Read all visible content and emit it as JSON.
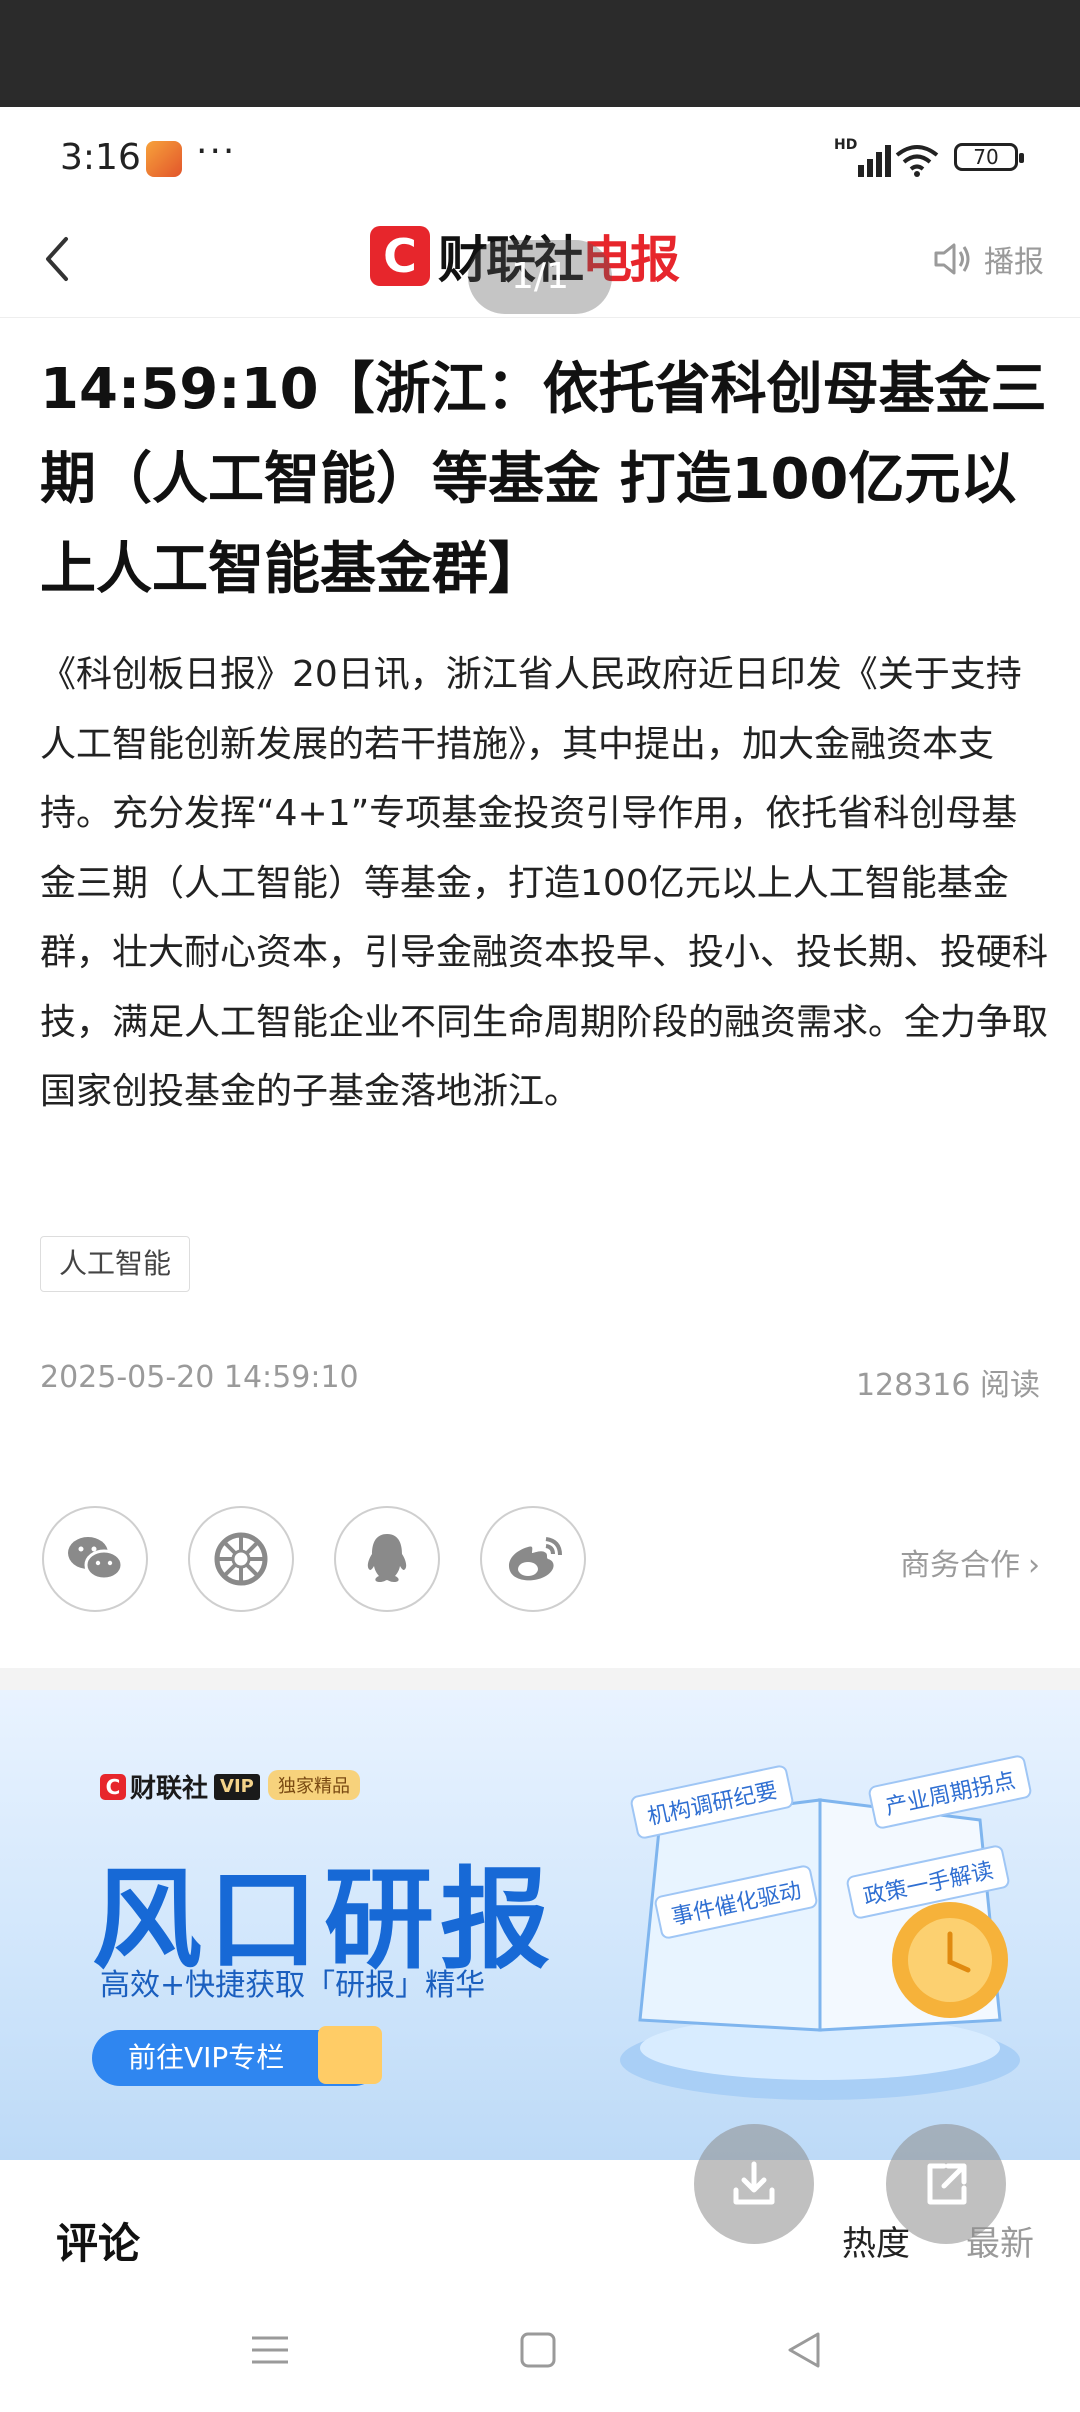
{
  "status_bar": {
    "time": "3:16",
    "more": "···",
    "signal": "HD",
    "battery": "70"
  },
  "nav": {
    "logo_mark": "C",
    "logo_text_1": "财联社",
    "logo_text_2": "电报",
    "broadcast_label": "播报",
    "page_indicator": "1/1"
  },
  "article": {
    "headline": "14:59:10【浙江：依托省科创母基金三期（人工智能）等基金 打造100亿元以上人工智能基金群】",
    "body": "《科创板日报》20日讯，浙江省人民政府近日印发《关于支持人工智能创新发展的若干措施》，其中提出，加大金融资本支持。充分发挥“4+1”专项基金投资引导作用，依托省科创母基金三期（人工智能）等基金，打造100亿元以上人工智能基金群，壮大耐心资本，引导金融资本投早、投小、投长期、投硬科技，满足人工智能企业不同生命周期阶段的融资需求。全力争取国家创投基金的子基金落地浙江。",
    "tag": "人工智能",
    "datetime": "2025-05-20 14:59:10",
    "reads": "128316 阅读"
  },
  "share": {
    "icons": [
      "wechat-icon",
      "moments-icon",
      "qq-icon",
      "weibo-icon"
    ],
    "business_label": "商务合作"
  },
  "banner": {
    "logo_mark": "C",
    "logo_text": "财联社",
    "vip": "VIP",
    "exclusive": "独家精品",
    "title": "风口研报",
    "subtitle": "高效+快捷获取「研报」精华",
    "button": "前往VIP专栏",
    "chips": [
      "机构调研纪要",
      "产业周期拐点",
      "事件催化驱动",
      "政策一手解读"
    ]
  },
  "comments": {
    "title": "评论",
    "sort_hot": "热度",
    "sort_new": "最新"
  },
  "colors": {
    "brand_red": "#e7262c",
    "banner_blue": "#1769d6"
  }
}
